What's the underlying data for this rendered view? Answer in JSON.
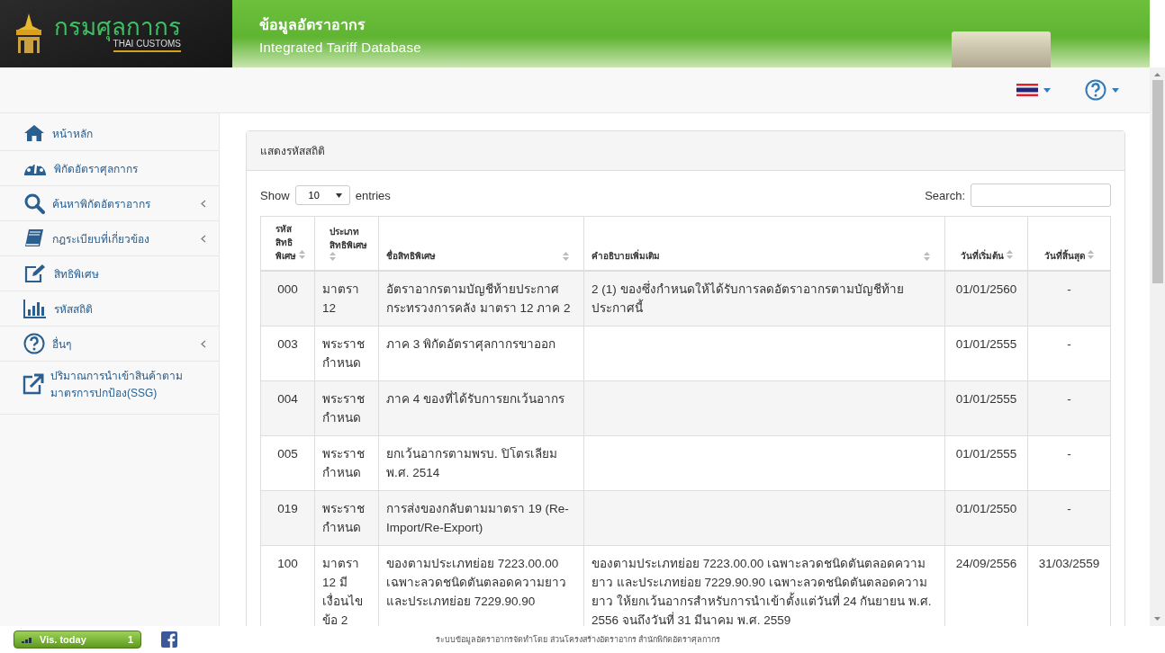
{
  "header": {
    "logo_text": "กรมศุลกากร",
    "logo_subtext": "THAI CUSTOMS",
    "title_th": "ข้อมูลอัตราอากร",
    "title_en": "Integrated Tariff Database"
  },
  "sidebar": {
    "items": [
      {
        "label": "หน้าหลัก",
        "kind": "home",
        "has_submenu": false
      },
      {
        "label": "พิกัดอัตราศุลกากร",
        "kind": "dashboard",
        "has_submenu": false
      },
      {
        "label": "ค้นหาพิกัดอัตราอากร",
        "kind": "search",
        "has_submenu": true
      },
      {
        "label": "กฎระเบียบที่เกี่ยวข้อง",
        "kind": "book",
        "has_submenu": true
      },
      {
        "label": "สิทธิพิเศษ",
        "kind": "edit",
        "has_submenu": false
      },
      {
        "label": "รหัสสถิติ",
        "kind": "chart",
        "has_submenu": false
      },
      {
        "label": "อื่นๆ",
        "kind": "question",
        "has_submenu": true
      },
      {
        "label": "ปริมาณการนำเข้าสินค้าตามมาตรการปกป้อง(SSG)",
        "kind": "external",
        "has_submenu": false
      }
    ]
  },
  "panel": {
    "title": "แสดงรหัสสถิติ",
    "show_label": "Show",
    "page_size": "10",
    "entries_label": "entries",
    "search_label": "Search:",
    "table": {
      "columns": [
        "รหัสสิทธิพิเศษ",
        "ประเภทสิทธิพิเศษ",
        "ชื่อสิทธิพิเศษ",
        "คำอธิบายเพิ่มเติม",
        "วันที่เริ่มต้น",
        "วันที่สิ้นสุด"
      ],
      "rows": [
        [
          "000",
          "มาตรา 12",
          "อัตราอากรตามบัญชีท้ายประกาศกระทรวงการคลัง มาตรา 12 ภาค 2",
          "2 (1) ของซึ่งกำหนดให้ได้รับการลดอัตราอากรตามบัญชีท้ายประกาศนี้",
          "01/01/2560",
          "-"
        ],
        [
          "003",
          "พระราชกำหนด",
          "ภาค 3 พิกัดอัตราศุลกากรขาออก",
          "",
          "01/01/2555",
          "-"
        ],
        [
          "004",
          "พระราชกำหนด",
          "ภาค 4 ของที่ได้รับการยกเว้นอากร",
          "",
          "01/01/2555",
          "-"
        ],
        [
          "005",
          "พระราชกำหนด",
          "ยกเว้นอากรตามพรบ. ปิโตรเลียม พ.ศ. 2514",
          "",
          "01/01/2555",
          "-"
        ],
        [
          "019",
          "พระราชกำหนด",
          "การส่งของกลับตามมาตรา 19 (Re-Import/Re-Export)",
          "",
          "01/01/2550",
          "-"
        ],
        [
          "100",
          "มาตรา 12 มีเงื่อนไขข้อ 2",
          "ของตามประเภทย่อย 7223.00.00 เฉพาะลวดชนิดตันตลอดความยาว และประเภทย่อย 7229.90.90",
          "ของตามประเภทย่อย 7223.00.00 เฉพาะลวดชนิดตันตลอดความยาว และประเภทย่อย 7229.90.90 เฉพาะลวดชนิดตันตลอดความยาว ให้ยกเว้นอากรสำหรับการนำเข้าตั้งแต่วันที่ 24 กันยายน พ.ศ. 2556 จนถึงวันที่ 31 มีนาคม พ.ศ. 2559",
          "24/09/2556",
          "31/03/2559"
        ]
      ]
    }
  },
  "footer": {
    "counter_label": "Vis. today",
    "counter_value": "1",
    "credit": "ระบบข้อมูลอัตราอากรจัดทำโดย ส่วนโครงสร้างอัตราอากร สำนักพิกัดอัตราศุลกากร"
  }
}
